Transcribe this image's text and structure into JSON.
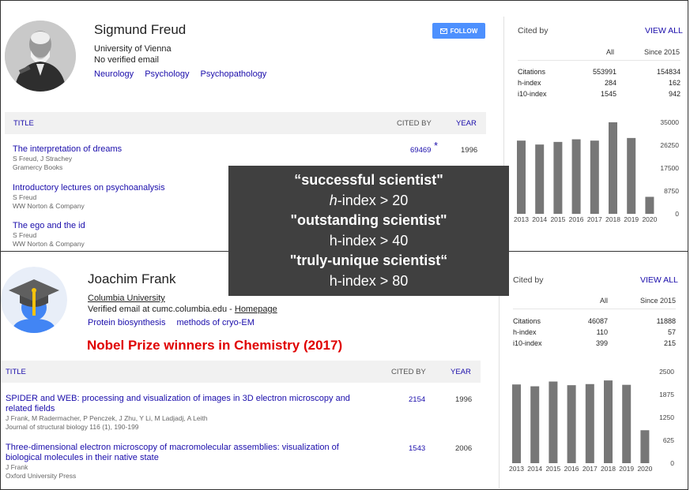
{
  "freud": {
    "name": "Sigmund Freud",
    "affiliation": "University of Vienna",
    "email": "No verified email",
    "keywords": [
      "Neurology",
      "Psychology",
      "Psychopathology"
    ],
    "follow_label": "FOLLOW",
    "table": {
      "title": "TITLE",
      "cited_by": "CITED BY",
      "year": "YEAR"
    },
    "articles": [
      {
        "title": "The interpretation of dreams",
        "authors": "S Freud, J Strachey",
        "venue": "Gramercy Books",
        "cited": "69469",
        "year": "1996",
        "star": "*"
      },
      {
        "title": "Introductory lectures on psychoanalysis",
        "authors": "S Freud",
        "venue": "WW Norton & Company"
      },
      {
        "title": "The ego and the id",
        "authors": "S Freud",
        "venue": "WW Norton & Company"
      }
    ],
    "cited": {
      "header": "Cited by",
      "view_all": "VIEW ALL",
      "col_all": "All",
      "col_since": "Since 2015",
      "rows": [
        {
          "label": "Citations",
          "all": "553991",
          "since": "154834"
        },
        {
          "label": "h-index",
          "all": "284",
          "since": "162"
        },
        {
          "label": "i10-index",
          "all": "1545",
          "since": "942"
        }
      ]
    }
  },
  "frank": {
    "name": "Joachim Frank",
    "affiliation": "Columbia University",
    "email_prefix": "Verified email at cumc.columbia.edu - ",
    "homepage": "Homepage",
    "keywords": [
      "Protein biosynthesis",
      "methods of cryo-EM"
    ],
    "table": {
      "title": "TITLE",
      "cited_by": "CITED BY",
      "year": "YEAR"
    },
    "articles": [
      {
        "title": "SPIDER and WEB: processing and visualization of images in 3D electron microscopy and related fields",
        "authors": "J Frank, M Radermacher, P Penczek, J Zhu, Y Li, M Ladjadj, A Leith",
        "venue": "Journal of structural biology 116 (1), 190-199",
        "cited": "2154",
        "year": "1996"
      },
      {
        "title": "Three-dimensional electron microscopy of macromolecular assemblies: visualization of biological molecules in their native state",
        "authors": "J Frank",
        "venue": "Oxford University Press",
        "cited": "1543",
        "year": "2006"
      }
    ],
    "cited": {
      "header": "Cited by",
      "view_all": "VIEW ALL",
      "col_all": "All",
      "col_since": "Since 2015",
      "rows": [
        {
          "label": "Citations",
          "all": "46087",
          "since": "11888"
        },
        {
          "label": "h-index",
          "all": "110",
          "since": "57"
        },
        {
          "label": "i10-index",
          "all": "399",
          "since": "215"
        }
      ]
    }
  },
  "overlay": {
    "l1": "“successful scientist\"",
    "l2a": "h",
    "l2b": "-index > 20",
    "l3": "\"outstanding scientist\"",
    "l4": "h-index  > 40",
    "l5": "\"truly-unique  scientist“",
    "l6": "h-index  > 80"
  },
  "nobel_label": "Nobel Prize winners in Chemistry (2017)",
  "chart_data": [
    {
      "type": "bar",
      "categories": [
        "2013",
        "2014",
        "2015",
        "2016",
        "2017",
        "2018",
        "2019",
        "2020"
      ],
      "values": [
        28000,
        26500,
        27500,
        28500,
        28000,
        35000,
        29000,
        6500
      ],
      "yticks": [
        "35000",
        "26250",
        "17500",
        "8750",
        "0"
      ],
      "ylim": [
        0,
        35000
      ],
      "bar_color": "#777777"
    },
    {
      "type": "bar",
      "categories": [
        "2013",
        "2014",
        "2015",
        "2016",
        "2017",
        "2018",
        "2019",
        "2020"
      ],
      "values": [
        2150,
        2100,
        2230,
        2130,
        2160,
        2260,
        2140,
        900
      ],
      "yticks": [
        "2500",
        "1875",
        "1250",
        "625",
        "0"
      ],
      "ylim": [
        0,
        2500
      ],
      "bar_color": "#777777"
    }
  ]
}
